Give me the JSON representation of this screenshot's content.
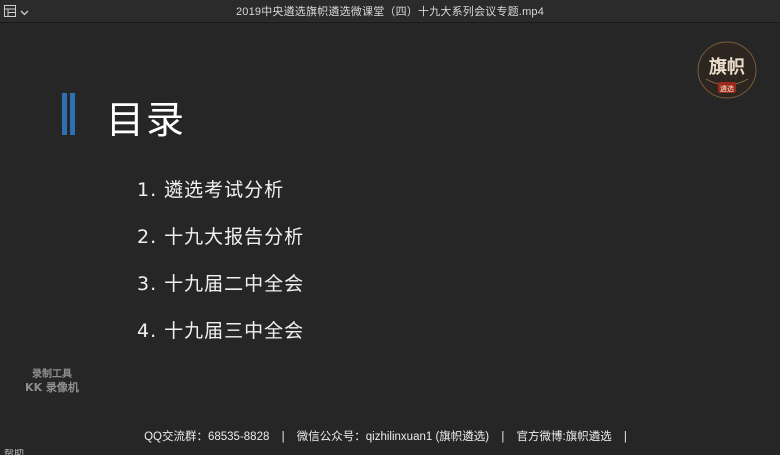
{
  "window": {
    "title": "2019中央遴选旗帜遴选微课堂（四）十九大系列会议专题.mp4",
    "menu_icon": "playlist-menu-icon",
    "dropdown_icon": "chevron-down-icon"
  },
  "slide": {
    "heading": "目录",
    "accent_color": "#2f6fb4",
    "items": [
      "1. 遴选考试分析",
      "2. 十九大报告分析",
      "3. 十九届二中全会",
      "4. 十九届三中全会"
    ],
    "logo": {
      "text_top": "旗帜",
      "text_badge": "遴选"
    },
    "watermark": {
      "line1": "录制工具",
      "line2": "KK 录像机"
    },
    "footer": {
      "qq": "QQ交流群：68535-8828",
      "sep1": "|",
      "wechat": "微信公众号：qizhilinxuan1 (旗帜遴选)",
      "sep2": "|",
      "weibo": "官方微博:旗帜遴选",
      "sep3": "|"
    }
  },
  "partial_text": "帮助"
}
